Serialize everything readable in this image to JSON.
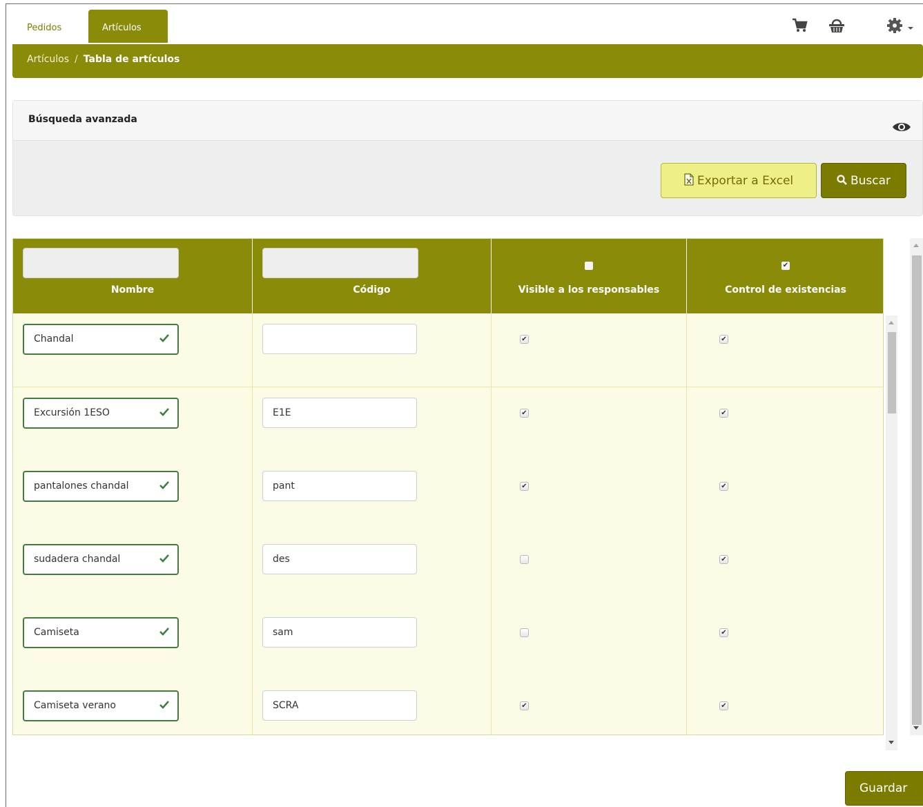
{
  "nav": {
    "tabs": [
      {
        "label": "Pedidos",
        "active": false
      },
      {
        "label": "Artículos",
        "active": true
      }
    ],
    "icons": [
      "cart-icon",
      "basket-icon",
      "gear-icon",
      "caret-down-icon"
    ]
  },
  "breadcrumb": {
    "parent": "Artículos",
    "separator": "/",
    "current": "Tabla de artículos"
  },
  "search": {
    "title": "Búsqueda avanzada",
    "export_label": "Exportar a Excel",
    "search_label": "Buscar"
  },
  "table": {
    "columns": [
      {
        "label": "Nombre"
      },
      {
        "label": "Código"
      },
      {
        "label": "Visible a los responsables",
        "header_checked": false
      },
      {
        "label": "Control de existencias",
        "header_checked": true
      }
    ],
    "rows": [
      {
        "nombre": "Chandal",
        "codigo": "",
        "visible": true,
        "control": true
      },
      {
        "nombre": "Excursión 1ESO",
        "codigo": "E1E",
        "visible": true,
        "control": true
      },
      {
        "nombre": "pantalones chandal",
        "codigo": "pant",
        "visible": true,
        "control": true
      },
      {
        "nombre": "sudadera chandal",
        "codigo": "des",
        "visible": false,
        "control": true
      },
      {
        "nombre": "Camiseta",
        "codigo": "sam",
        "visible": false,
        "control": true
      },
      {
        "nombre": "Camiseta verano",
        "codigo": "SCRA",
        "visible": true,
        "control": true
      }
    ]
  },
  "footer": {
    "save_label": "Guardar"
  },
  "colors": {
    "accent": "#8b8b0a",
    "valid": "#3f7d3f",
    "row_bg": "#fbfbe6"
  }
}
